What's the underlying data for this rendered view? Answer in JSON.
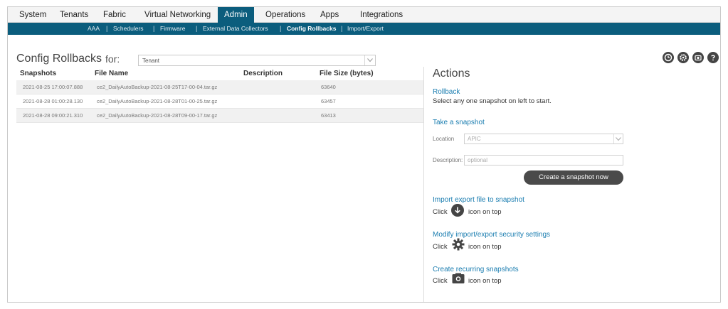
{
  "nav": {
    "tabs": [
      "System",
      "Tenants",
      "Fabric",
      "Virtual Networking",
      "Admin",
      "Operations",
      "Apps",
      "Integrations"
    ],
    "active": "Admin"
  },
  "subnav": {
    "items": [
      "AAA",
      "Schedulers",
      "Firmware",
      "External Data Collectors",
      "Config Rollbacks",
      "Import/Export"
    ],
    "active": "Config Rollbacks"
  },
  "header": {
    "title": "Config Rollbacks",
    "for_label": "for:",
    "scope_value": "Tenant"
  },
  "table": {
    "columns": [
      "Snapshots",
      "File Name",
      "Description",
      "File Size (bytes)"
    ],
    "rows": [
      {
        "snapshot": "2021-08-25 17:00:07.888",
        "file": "ce2_DailyAutoBackup-2021-08-25T17-00-04.tar.gz",
        "description": "",
        "size": "63640"
      },
      {
        "snapshot": "2021-08-28 01:00:28.130",
        "file": "ce2_DailyAutoBackup-2021-08-28T01-00-25.tar.gz",
        "description": "",
        "size": "63457"
      },
      {
        "snapshot": "2021-08-28 09:00:21.310",
        "file": "ce2_DailyAutoBackup-2021-08-28T09-00-17.tar.gz",
        "description": "",
        "size": "63413"
      }
    ]
  },
  "toolbar_icons": [
    "clock-icon",
    "gear-icon",
    "camera-icon",
    "help-icon"
  ],
  "actions": {
    "title": "Actions",
    "rollback_link": "Rollback",
    "rollback_text": "Select any one snapshot on left to start.",
    "snapshot_link": "Take a snapshot",
    "location_label": "Location",
    "location_value": "APIC",
    "description_label": "Description:",
    "description_placeholder": "optional",
    "create_button": "Create a snapshot now",
    "import_link": "Import export file to snapshot",
    "modify_link": "Modify import/export security settings",
    "recurring_link": "Create recurring snapshots",
    "click_word": "Click",
    "icon_on_top": "icon on top"
  }
}
